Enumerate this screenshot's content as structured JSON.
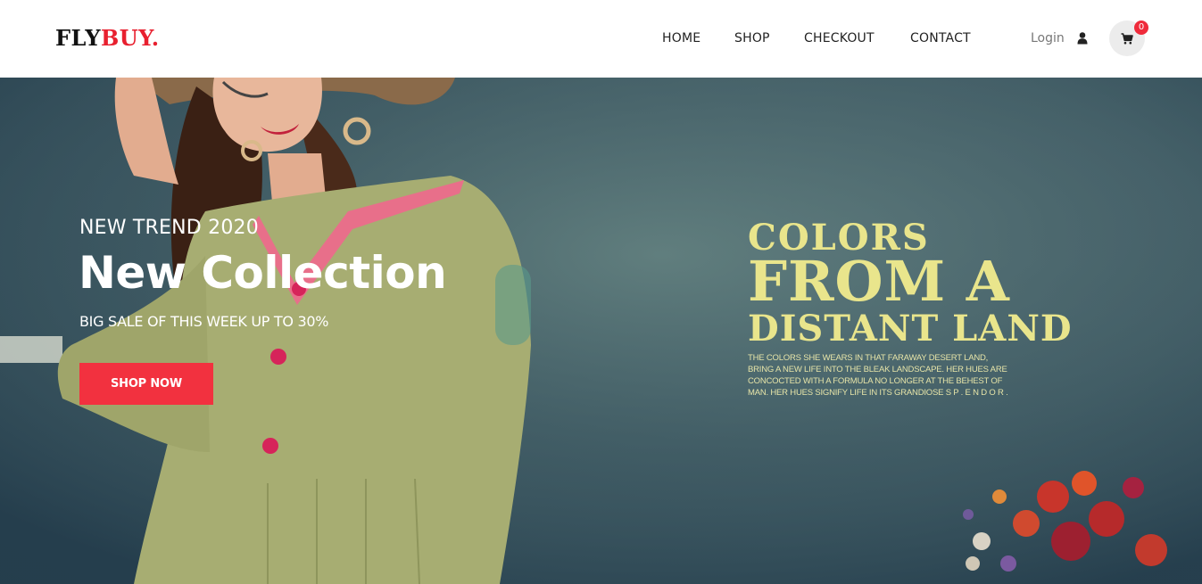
{
  "brand": {
    "logo_part1": "FLY",
    "logo_part2": "BUY."
  },
  "nav": {
    "items": [
      {
        "label": "HOME"
      },
      {
        "label": "SHOP"
      },
      {
        "label": "CHECKOUT"
      },
      {
        "label": "CONTACT"
      }
    ],
    "login_label": "Login",
    "user_icon": "user-icon",
    "cart_icon": "cart-icon",
    "cart_count": "0"
  },
  "hero": {
    "eyebrow": "NEW TREND 2020",
    "title": "New Collection",
    "subtitle": "BIG SALE OF THIS WEEK UP TO 30%",
    "button_label": "SHOP NOW",
    "poster": {
      "line1": "COLORS",
      "line2": "FROM A",
      "line3": "DISTANT LAND",
      "blurb": "THE COLORS SHE WEARS IN THAT FARAWAY DESERT LAND, BRING A NEW LIFE INTO THE BLEAK LANDSCAPE. HER HUES ARE CONCOCTED WITH A FORMULA NO LONGER AT THE BEHEST OF MAN. HER HUES SIGNIFY LIFE IN ITS GRANDIOSE S P . E N D O R ."
    }
  },
  "colors": {
    "accent": "#f2313f",
    "logo_accent": "#e8202f",
    "poster_text": "#e9e58c",
    "hero_bg": "#3f5a63"
  }
}
